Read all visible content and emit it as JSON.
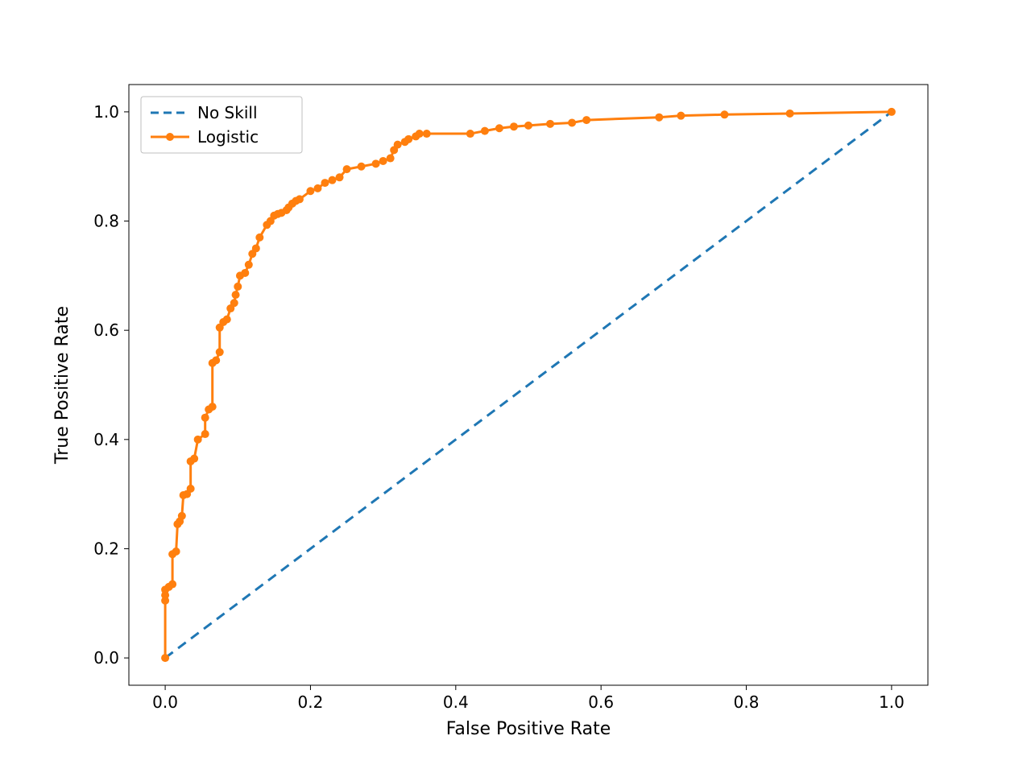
{
  "chart_data": {
    "type": "line",
    "title": "",
    "xlabel": "False Positive Rate",
    "ylabel": "True Positive Rate",
    "xlim": [
      -0.05,
      1.05
    ],
    "ylim": [
      -0.05,
      1.05
    ],
    "xticks": [
      0.0,
      0.2,
      0.4,
      0.6,
      0.8,
      1.0
    ],
    "yticks": [
      0.0,
      0.2,
      0.4,
      0.6,
      0.8,
      1.0
    ],
    "legend": {
      "position": "upper left",
      "entries": [
        "No Skill",
        "Logistic"
      ]
    },
    "series": [
      {
        "name": "No Skill",
        "style": "dashed",
        "color": "#1f77b4",
        "marker": false,
        "x": [
          0,
          1
        ],
        "y": [
          0,
          1
        ]
      },
      {
        "name": "Logistic",
        "style": "solid",
        "color": "#ff7f0e",
        "marker": true,
        "x": [
          0.0,
          0.0,
          0.0,
          0.0,
          0.005,
          0.01,
          0.01,
          0.015,
          0.017,
          0.02,
          0.023,
          0.025,
          0.03,
          0.035,
          0.035,
          0.04,
          0.045,
          0.055,
          0.055,
          0.06,
          0.065,
          0.065,
          0.07,
          0.075,
          0.075,
          0.08,
          0.085,
          0.09,
          0.095,
          0.097,
          0.1,
          0.103,
          0.11,
          0.115,
          0.12,
          0.125,
          0.13,
          0.14,
          0.145,
          0.15,
          0.155,
          0.16,
          0.167,
          0.17,
          0.175,
          0.18,
          0.185,
          0.2,
          0.21,
          0.22,
          0.23,
          0.24,
          0.25,
          0.27,
          0.29,
          0.3,
          0.31,
          0.315,
          0.32,
          0.33,
          0.335,
          0.345,
          0.35,
          0.36,
          0.42,
          0.44,
          0.46,
          0.48,
          0.5,
          0.53,
          0.56,
          0.58,
          0.68,
          0.71,
          0.77,
          0.86,
          1.0
        ],
        "y": [
          0.0,
          0.105,
          0.115,
          0.125,
          0.13,
          0.135,
          0.19,
          0.195,
          0.245,
          0.25,
          0.26,
          0.298,
          0.3,
          0.31,
          0.36,
          0.365,
          0.4,
          0.41,
          0.44,
          0.455,
          0.46,
          0.54,
          0.545,
          0.56,
          0.605,
          0.615,
          0.62,
          0.64,
          0.65,
          0.665,
          0.68,
          0.7,
          0.705,
          0.72,
          0.74,
          0.75,
          0.77,
          0.793,
          0.8,
          0.81,
          0.813,
          0.815,
          0.82,
          0.825,
          0.832,
          0.837,
          0.84,
          0.855,
          0.86,
          0.87,
          0.875,
          0.88,
          0.895,
          0.9,
          0.905,
          0.91,
          0.915,
          0.93,
          0.94,
          0.945,
          0.95,
          0.955,
          0.96,
          0.96,
          0.96,
          0.965,
          0.97,
          0.973,
          0.975,
          0.978,
          0.98,
          0.985,
          0.99,
          0.993,
          0.995,
          0.997,
          1.0
        ]
      }
    ]
  },
  "colors": {
    "no_skill": "#1f77b4",
    "logistic": "#ff7f0e",
    "axis": "#000000",
    "legend_frame": "#bfbfbf"
  }
}
